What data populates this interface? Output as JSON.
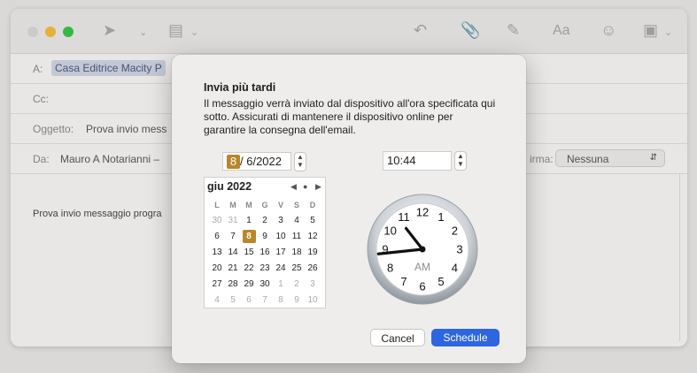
{
  "toolbar": {
    "icons": [
      "send-icon",
      "chevron-down-icon",
      "header-fields-icon",
      "chevron-down-icon",
      "reply-icon",
      "paperclip-icon",
      "compose-icon",
      "font-icon",
      "emoji-icon",
      "photo-icon",
      "chevron-down-icon"
    ],
    "font_glyph": "Aa"
  },
  "compose": {
    "to_label": "A:",
    "to_value": "Casa Editrice Macity P",
    "cc_label": "Cc:",
    "subject_label": "Oggetto:",
    "subject_value": "Prova invio mess",
    "from_label": "Da:",
    "from_value": "Mauro A Notarianni –",
    "signature_label": "irma:",
    "signature_value": "Nessuna",
    "body": "Prova invio messaggio progra"
  },
  "dialog": {
    "title": "Invia più tardi",
    "description": "Il messaggio verrà inviato dal dispositivo all'ora specificata qui sotto. Assicurati di mantenere il dispositivo online per garantire la consegna dell'email.",
    "date_day": "8",
    "date_rest": "/ 6/2022",
    "time": "10:44",
    "calendar": {
      "month_label": "giu 2022",
      "weekdays": [
        "L",
        "M",
        "M",
        "G",
        "V",
        "S",
        "D"
      ],
      "weeks": [
        [
          "30",
          "31",
          "1",
          "2",
          "3",
          "4",
          "5"
        ],
        [
          "6",
          "7",
          "8",
          "9",
          "10",
          "11",
          "12"
        ],
        [
          "13",
          "14",
          "15",
          "16",
          "17",
          "18",
          "19"
        ],
        [
          "20",
          "21",
          "22",
          "23",
          "24",
          "25",
          "26"
        ],
        [
          "27",
          "28",
          "29",
          "30",
          "1",
          "2",
          "3"
        ],
        [
          "4",
          "5",
          "6",
          "7",
          "8",
          "9",
          "10"
        ]
      ]
    },
    "clock": {
      "numbers": [
        "12",
        "1",
        "2",
        "3",
        "4",
        "5",
        "6",
        "7",
        "8",
        "9",
        "10",
        "11"
      ],
      "period": "AM",
      "hour": 10,
      "minute": 44
    },
    "cancel_label": "Cancel",
    "schedule_label": "Schedule"
  },
  "colors": {
    "accent": "#2d66e0",
    "selection": "#b8862b",
    "chip": "#ccd3e0"
  }
}
